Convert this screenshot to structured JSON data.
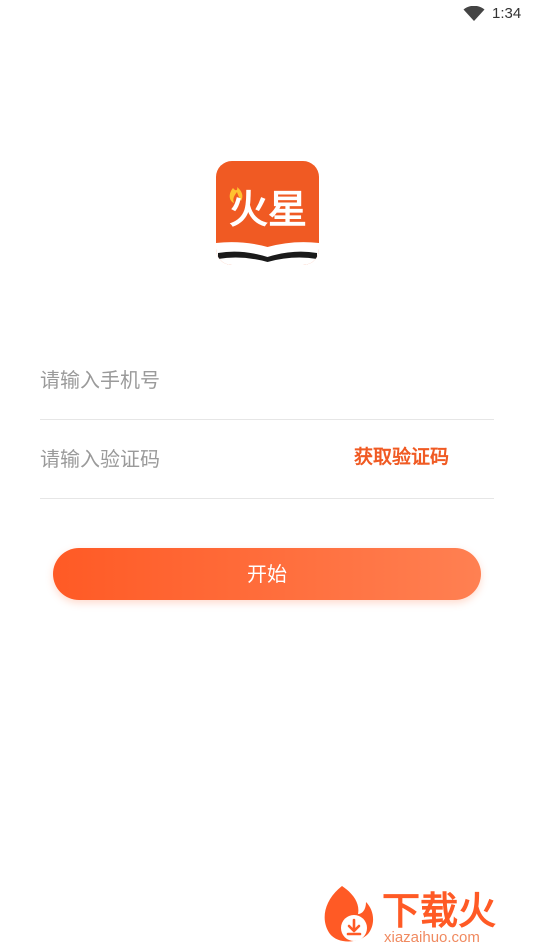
{
  "status_bar": {
    "time": "1:34",
    "wifi_icon": "wifi-icon"
  },
  "app": {
    "logo_text": "火星",
    "logo_icon": "book-flame-logo",
    "brand_color": "#f05a23"
  },
  "form": {
    "phone_placeholder": "请输入手机号",
    "phone_value": "",
    "code_placeholder": "请输入验证码",
    "code_value": "",
    "get_code_label": "获取验证码"
  },
  "start_button": {
    "label": "开始"
  },
  "footer": {
    "brand_name": "下载火",
    "brand_domain": "xiazaihuo.com",
    "brand_icon": "flame-download-icon"
  }
}
